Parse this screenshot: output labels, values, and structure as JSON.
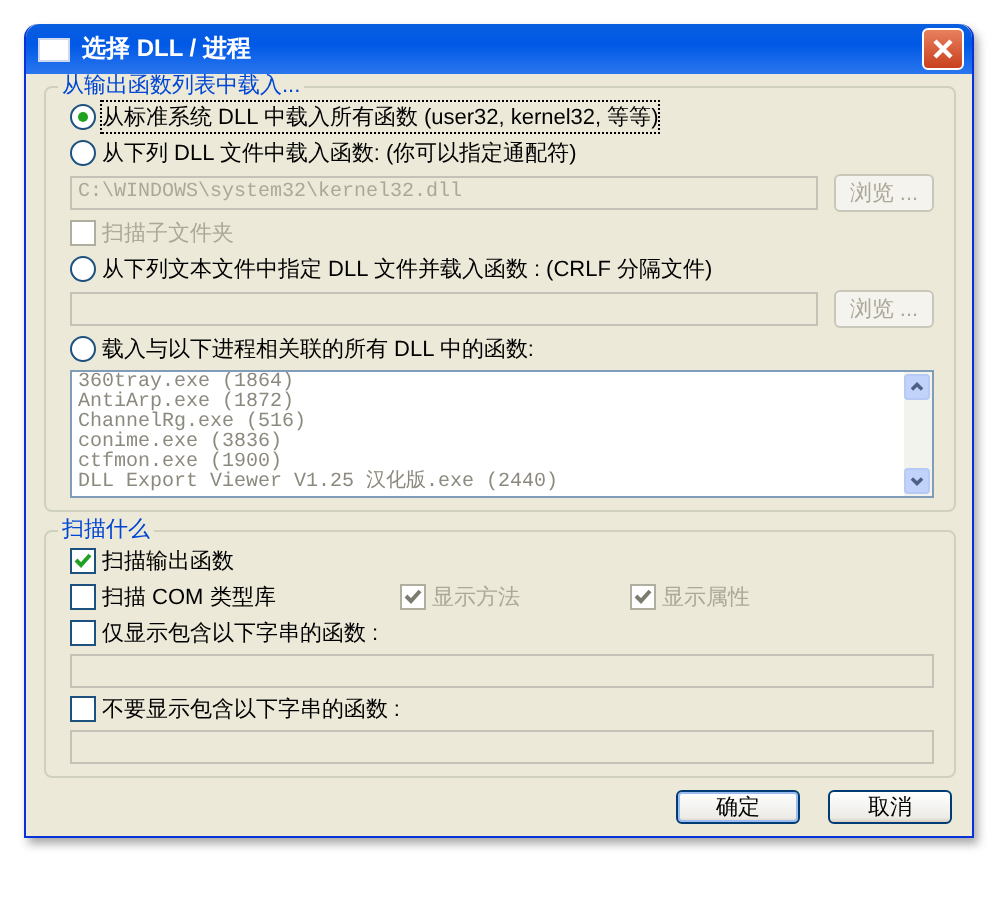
{
  "window": {
    "title": "选择 DLL / 进程"
  },
  "load_group": {
    "title": "从输出函数列表中载入...",
    "items": [
      {
        "kind": "radio",
        "label": "从标准系统 DLL 中载入所有函数 (user32, kernel32, 等等)",
        "selected": true,
        "focused": true
      },
      {
        "kind": "radio",
        "label": "从下列 DLL 文件中载入函数: (你可以指定通配符)",
        "selected": false,
        "focused": false
      },
      {
        "kind": "file_field",
        "value": "C:\\WINDOWS\\system32\\kernel32.dll",
        "disabled": true,
        "button": "浏览 ..."
      },
      {
        "kind": "checkbox",
        "label": "扫描子文件夹",
        "checked": false,
        "disabled": true
      },
      {
        "kind": "radio",
        "label": "从下列文本文件中指定 DLL 文件并载入函数 : (CRLF 分隔文件)",
        "selected": false,
        "focused": false
      },
      {
        "kind": "file_field",
        "disabled": true,
        "button": "浏览 ..."
      },
      {
        "kind": "radio",
        "label": "载入与以下进程相关联的所有 DLL 中的函数:",
        "selected": false,
        "focused": false
      },
      {
        "kind": "process_list",
        "disabled": true,
        "rows": [
          "360tray.exe  (1864)",
          "AntiArp.exe  (1872)",
          "ChannelRg.exe  (516)",
          "conime.exe  (3836)",
          "ctfmon.exe  (1900)",
          "DLL Export Viewer V1.25 汉化版.exe  (2440)"
        ]
      }
    ]
  },
  "scan_group": {
    "title": "扫描什么",
    "items": [
      {
        "kind": "checkbox_row",
        "boxes": [
          {
            "label": "扫描输出函数",
            "checked": true,
            "disabled": false
          }
        ]
      },
      {
        "kind": "checkbox_row",
        "boxes": [
          {
            "label": "扫描 COM 类型库",
            "checked": false,
            "disabled": false
          },
          {
            "label": "显示方法",
            "checked": true,
            "disabled": true
          },
          {
            "label": "显示属性",
            "checked": true,
            "disabled": true
          }
        ]
      },
      {
        "kind": "checkbox_row",
        "boxes": [
          {
            "label": "仅显示包含以下字串的函数 :",
            "checked": false,
            "disabled": false
          }
        ]
      },
      {
        "kind": "text_field",
        "disabled": true
      },
      {
        "kind": "checkbox_row",
        "boxes": [
          {
            "label": "不要显示包含以下字串的函数 :",
            "checked": false,
            "disabled": false
          }
        ]
      },
      {
        "kind": "text_field",
        "disabled": true
      }
    ]
  },
  "buttons": [
    {
      "label": "确定",
      "default": true
    },
    {
      "label": "取消",
      "default": false
    }
  ]
}
